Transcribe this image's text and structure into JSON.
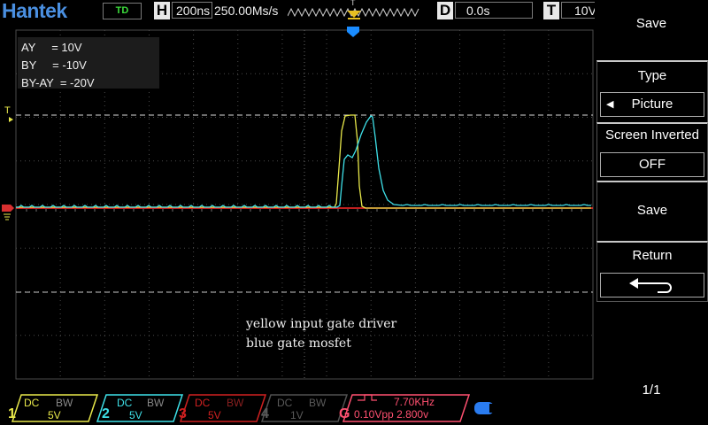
{
  "header": {
    "brand": "Hantek",
    "mode": "TD",
    "horizontal_letter": "H",
    "timebase": "200ns",
    "sample_rate": "250.00Ms/s",
    "delay_letter": "D",
    "delay": "0.0s",
    "trigger_letter": "T",
    "trigger_level": "10V",
    "trigger_marker": "T"
  },
  "measurements": {
    "ay": "AY     = 10V",
    "by": "BY     = -10V",
    "diff": "BY-AY  = -20V"
  },
  "annotation": {
    "line1": "yellow input gate driver",
    "line2": "blue gate mosfet"
  },
  "menu": {
    "title": "Save",
    "type_label": "Type",
    "type_value": "Picture",
    "screen_inverted_label": "Screen Inverted",
    "screen_inverted_value": "OFF",
    "save_label": "Save",
    "return_label": "Return",
    "page": "1/1"
  },
  "channels": [
    {
      "num": "1",
      "coupling": "DC",
      "bw": "BW",
      "scale": "5V",
      "color": "#e8e84a",
      "active": true
    },
    {
      "num": "2",
      "coupling": "DC",
      "bw": "BW",
      "scale": "5V",
      "color": "#3ee0e8",
      "active": true
    },
    {
      "num": "3",
      "coupling": "DC",
      "bw": "BW",
      "scale": "5V",
      "color": "#d02020",
      "active": false
    },
    {
      "num": "4",
      "coupling": "DC",
      "bw": "BW",
      "scale": "1V",
      "color": "#505050",
      "active": false
    }
  ],
  "generator": {
    "letter": "G",
    "frequency": "7.70KHz",
    "amplitude": "0.10Vpp",
    "offset": "2.800v",
    "color": "#ff5070"
  },
  "colors": {
    "ch1": "#e8e84a",
    "ch2": "#3ee0e8",
    "ref_line": "#ff2a2a",
    "grid": "#4a4a4a",
    "trigger": "#1a8cff"
  },
  "icons": {
    "usb": "usb-icon",
    "return": "return-arrow-icon",
    "left_arrow": "left-arrow-icon"
  }
}
